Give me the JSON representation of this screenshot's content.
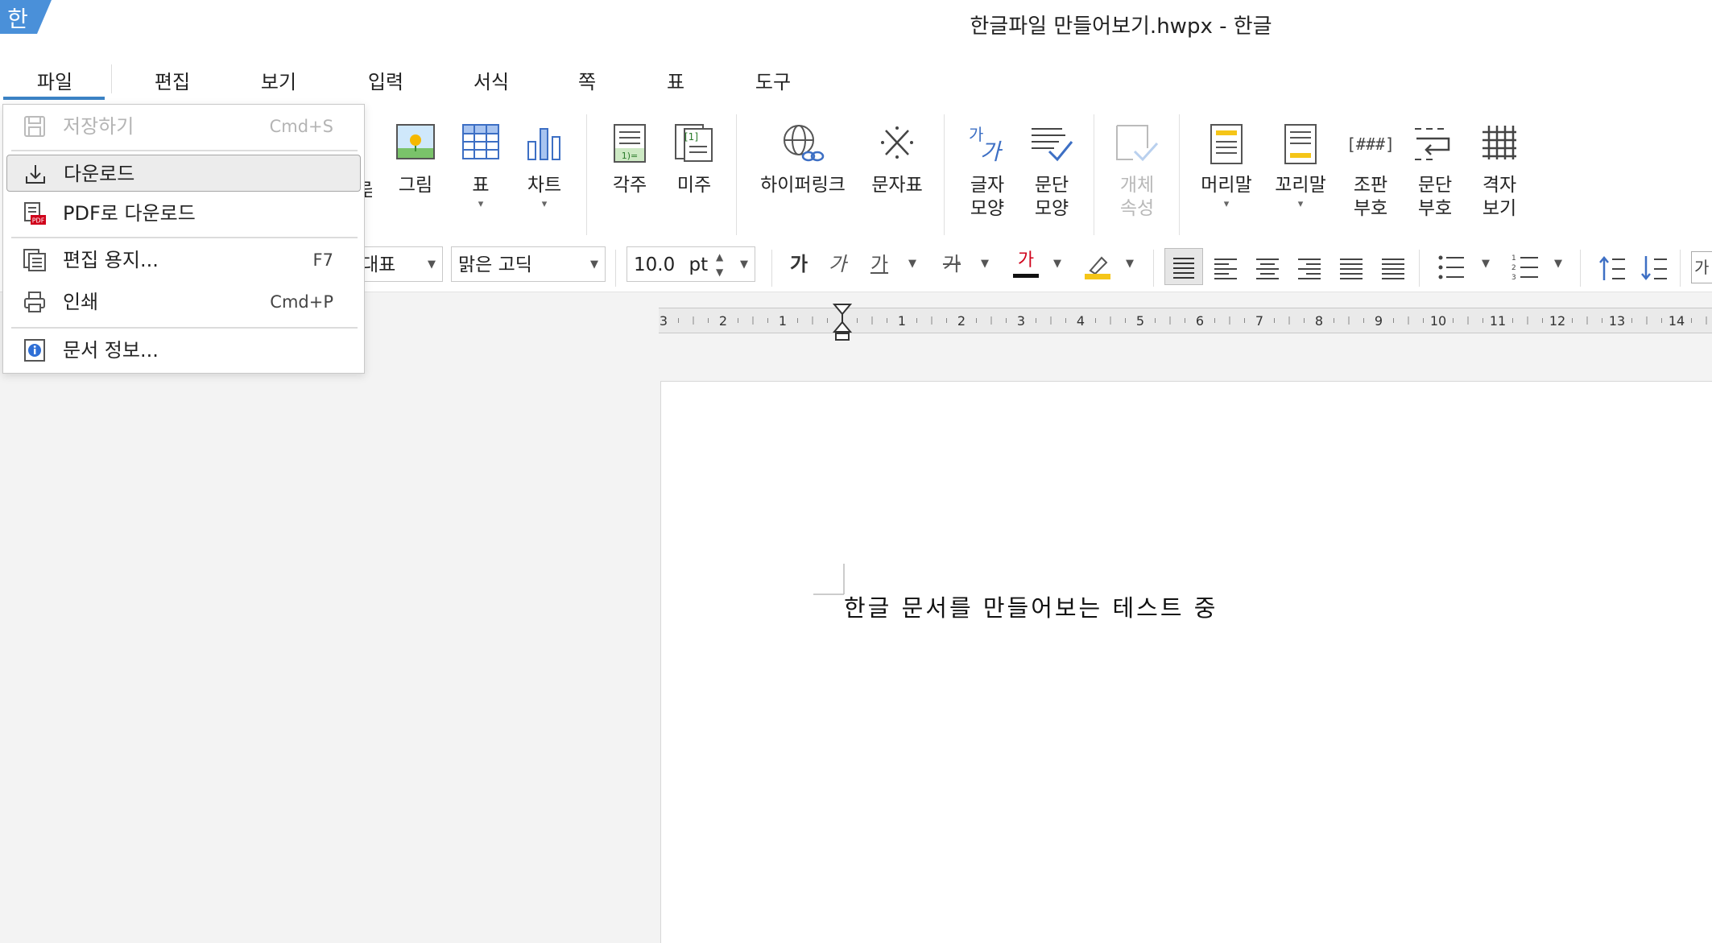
{
  "window": {
    "title": "한글파일 만들어보기.hwpx - 한글",
    "logo_text": "한"
  },
  "menubar": {
    "tabs": [
      "파일",
      "편집",
      "보기",
      "입력",
      "서식",
      "쪽",
      "표",
      "도구"
    ],
    "active": "파일"
  },
  "ribbon": {
    "partial_label": "림",
    "buttons": [
      {
        "label": "그림",
        "icon": "picture-icon"
      },
      {
        "label": "표",
        "icon": "table-icon"
      },
      {
        "label": "차트",
        "icon": "chart-icon"
      },
      {
        "label": "각주",
        "icon": "footnote-icon"
      },
      {
        "label": "미주",
        "icon": "endnote-icon"
      },
      {
        "label": "하이퍼링크",
        "icon": "hyperlink-icon"
      },
      {
        "label": "문자표",
        "icon": "symbol-icon"
      },
      {
        "label1": "글자",
        "label2": "모양",
        "icon": "char-shape-icon"
      },
      {
        "label1": "문단",
        "label2": "모양",
        "icon": "para-shape-icon"
      },
      {
        "label1": "개체",
        "label2": "속성",
        "icon": "object-props-icon",
        "disabled": true
      },
      {
        "label": "머리말",
        "icon": "header-icon"
      },
      {
        "label": "꼬리말",
        "icon": "footer-icon"
      },
      {
        "label1": "조판",
        "label2": "부호",
        "icon": "markup-icon"
      },
      {
        "label1": "문단",
        "label2": "부호",
        "icon": "para-mark-icon"
      },
      {
        "label1": "격자",
        "label2": "보기",
        "icon": "grid-view-icon"
      }
    ]
  },
  "formatbar": {
    "style_value": "대표",
    "font_value": "맑은 고딕",
    "size_value": "10.0",
    "size_unit": "pt",
    "bold_glyph": "가",
    "italic_glyph": "가",
    "underline_glyph": "가",
    "strike_glyph": "가",
    "color_glyph": "가",
    "partial_glyph": "가"
  },
  "ruler": {
    "left_numbers": [
      "3",
      "2",
      "1"
    ],
    "right_numbers": [
      "1",
      "2",
      "3",
      "4",
      "5",
      "6",
      "7",
      "8",
      "9",
      "10",
      "11",
      "12",
      "13",
      "14"
    ]
  },
  "document": {
    "text": "한글 문서를 만들어보는 테스트 중"
  },
  "file_menu": {
    "items": [
      {
        "label": "저장하기",
        "shortcut": "Cmd+S",
        "icon": "save-icon",
        "disabled": true
      },
      {
        "label": "다운로드",
        "shortcut": "",
        "icon": "download-icon",
        "selected": true
      },
      {
        "label": "PDF로 다운로드",
        "shortcut": "",
        "icon": "pdf-icon"
      },
      {
        "label": "편집 용지...",
        "shortcut": "F7",
        "icon": "page-setup-icon"
      },
      {
        "label": "인쇄",
        "shortcut": "Cmd+P",
        "icon": "print-icon"
      },
      {
        "label": "문서 정보...",
        "shortcut": "",
        "icon": "info-icon"
      }
    ]
  },
  "colors": {
    "accent": "#3b82c4",
    "logo_bg": "#4a90d9",
    "text_color_bar": "#d0021b",
    "highlight_bar": "#f5c518"
  }
}
